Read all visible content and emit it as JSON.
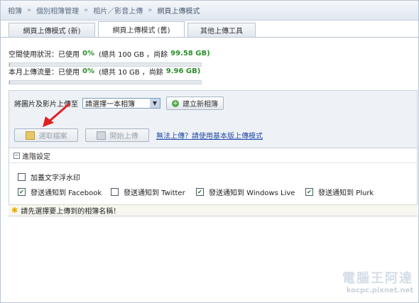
{
  "breadcrumb": [
    "相簿",
    "個別相簿管理",
    "相片／影音上傳",
    "網頁上傳模式"
  ],
  "tabs": [
    "網頁上傳模式 (新)",
    "網頁上傳模式 (舊)",
    "其他上傳工具"
  ],
  "quota_space": {
    "label": "空間使用狀況：已使用",
    "pct": "0%",
    "total": "(總共 100 GB ，尚餘",
    "remain": "99.58 GB)",
    "used_fraction": 0.004
  },
  "quota_month": {
    "label": "本月上傳流量：已使用",
    "pct": "0%",
    "total": "(總共 10 GB ，尚餘",
    "remain": "9.96 GB)",
    "used_fraction": 0.004
  },
  "upload_to_label": "將圖片及影片上傳至",
  "album_select": "請選擇一本相簿",
  "new_album_button": "建立新相簿",
  "select_file_button": "選取檔案",
  "start_upload_button": "開始上傳",
  "fallback_link": "無法上傳？請使用基本版上傳模式",
  "advanced_title": "進階設定",
  "options": [
    {
      "label": "加蓋文字浮水印",
      "checked": false
    },
    {
      "label": "發送通知到 Facebook",
      "checked": true
    },
    {
      "label": "發送通知到 Twitter",
      "checked": false
    },
    {
      "label": "發送通知到 Windows Live",
      "checked": true
    },
    {
      "label": "發送通知到 Plurk",
      "checked": true
    }
  ],
  "warning": "請先選擇要上傳到的相簿名稱！",
  "watermark": {
    "title": "電腦王阿達",
    "url": "kocpc.pixnet.net"
  },
  "colors": {
    "accent_green": "#2a8f2a",
    "link": "#2148a8",
    "arrow": "#e02020"
  }
}
